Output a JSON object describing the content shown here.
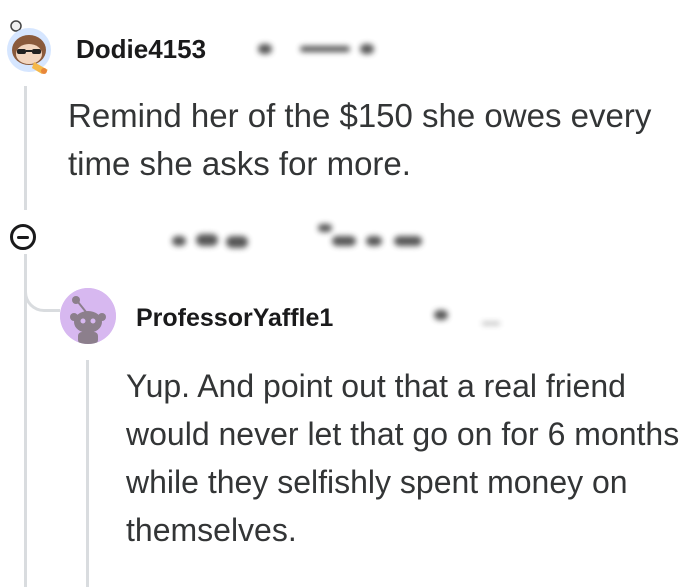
{
  "comment": {
    "username": "Dodie4153",
    "body": "Remind her of the $150 she owes every time she asks for more.",
    "avatar_icon": "snoo-avatar-icon"
  },
  "reply": {
    "username": "ProfessorYaffle1",
    "body": "Yup. And point out that a real friend would never let that go on for 6 months while they selfishly spent money on themselves.",
    "avatar_icon": "snoo-default-avatar-icon"
  },
  "controls": {
    "collapse_icon": "collapse-minus-icon"
  },
  "colors": {
    "thread_line": "#d9dcdf",
    "reply_avatar_bg": "#d7b8f0",
    "text": "#333536"
  }
}
